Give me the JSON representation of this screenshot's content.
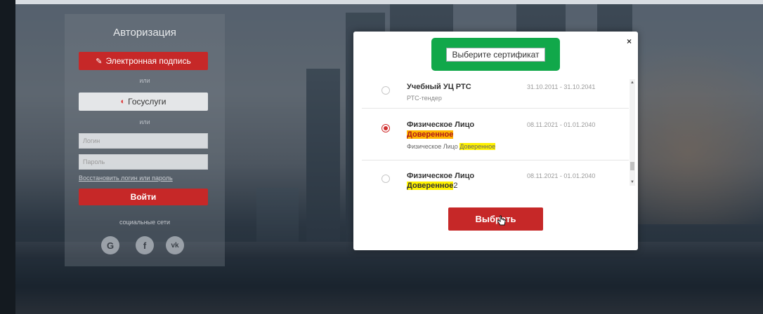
{
  "login": {
    "title": "Авторизация",
    "esign_label": "Электронная подпись",
    "or1": "или",
    "gosuslugi_label": "Госуслуги",
    "or2": "или",
    "login_placeholder": "Логин",
    "password_placeholder": "Пароль",
    "restore_link": "Восстановить логин или пароль",
    "login_button": "Войти",
    "social_label": "социальные сети",
    "social": [
      "G",
      "f",
      "vk"
    ]
  },
  "modal": {
    "title": "Выберите сертификат",
    "close": "×",
    "certs": [
      {
        "name": "Учебный УЦ РТС",
        "sub": "РТС-тендер",
        "dates": "31.10.2011 - 31.10.2041",
        "selected": false
      },
      {
        "name": "Физическое Лицо",
        "name_highlight": "Доверенное",
        "sub": "Физическое Лицо",
        "sub_highlight": "Доверенное",
        "dates": "08.11.2021 - 01.01.2040",
        "selected": true
      },
      {
        "name": "Физическое Лицо",
        "name_highlight": "Доверенное",
        "name_suffix": "2",
        "dates": "08.11.2021 - 01.01.2040",
        "selected": false
      }
    ],
    "select_button": "Выбрать"
  },
  "colors": {
    "accent_red": "#c62828",
    "title_box_green": "#11a84a",
    "highlight_yellow": "#fff200",
    "highlight_orange": "#ffb400"
  }
}
